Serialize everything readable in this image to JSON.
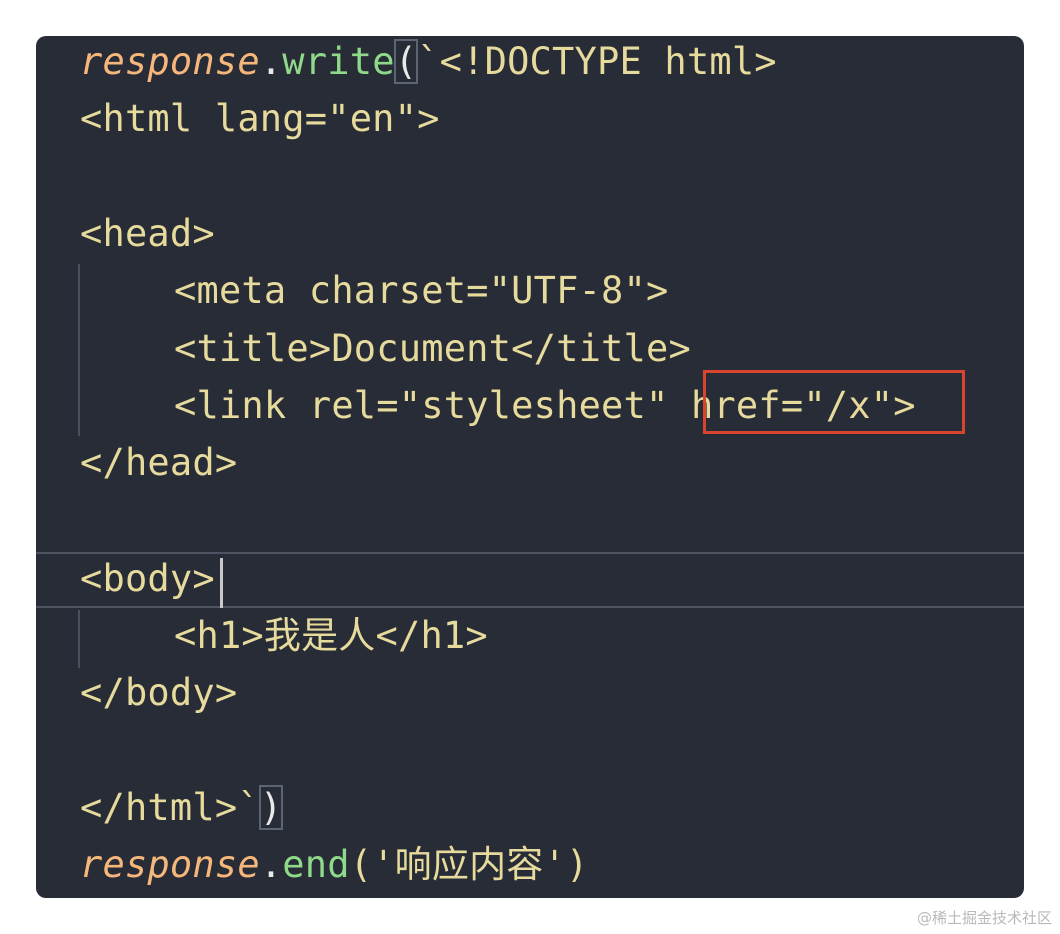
{
  "code": {
    "line1": {
      "object": "response",
      "dot": ".",
      "method": "write",
      "open_paren": "(",
      "rest": "`<!DOCTYPE html>"
    },
    "line2": "<html lang=\"en\">",
    "line4": "<head>",
    "line5": "<meta charset=\"UTF-8\">",
    "line6": "<title>Document</title>",
    "line7": {
      "before": "<link rel=\"stylesheet\" ",
      "highlighted": "href=\"/x\">"
    },
    "line8": "</head>",
    "line10": "<body>",
    "line11": "<h1>我是人</h1>",
    "line12": "</body>",
    "line14": {
      "text": "</html>`",
      "close_paren": ")"
    },
    "line15": {
      "object": "response",
      "dot": ".",
      "method": "end",
      "args": "('响应内容')"
    }
  },
  "colors": {
    "background": "#282c37",
    "object": "#f6b77c",
    "method": "#8fd98a",
    "string": "#e6db9c",
    "highlight_border": "#d9442f"
  },
  "watermark": "@稀土掘金技术社区"
}
